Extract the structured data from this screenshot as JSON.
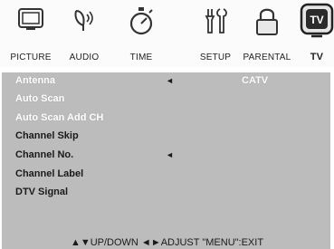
{
  "tabs": [
    {
      "label": "PICTURE",
      "icon": "picture-icon"
    },
    {
      "label": "AUDIO",
      "icon": "audio-icon"
    },
    {
      "label": "TIME",
      "icon": "stopwatch-icon"
    },
    {
      "label": "SETUP",
      "icon": "tools-icon"
    },
    {
      "label": "PARENTAL",
      "icon": "lock-icon"
    },
    {
      "label": "TV",
      "icon": "tv-icon",
      "active": true
    }
  ],
  "menu": {
    "items": [
      {
        "label": "Antenna",
        "highlighted": true
      },
      {
        "label": "Auto Scan",
        "highlighted": true
      },
      {
        "label": "Auto Scan Add CH",
        "highlighted": true
      },
      {
        "label": "Channel Skip",
        "highlighted": false
      },
      {
        "label": "Channel No.",
        "highlighted": false
      },
      {
        "label": "Channel Label",
        "highlighted": false
      },
      {
        "label": "DTV Signal",
        "highlighted": false
      }
    ],
    "antenna_value": "CATV"
  },
  "footer": {
    "hint": "▲▼UP/DOWN ◄►ADJUST \"MENU\":EXIT"
  }
}
